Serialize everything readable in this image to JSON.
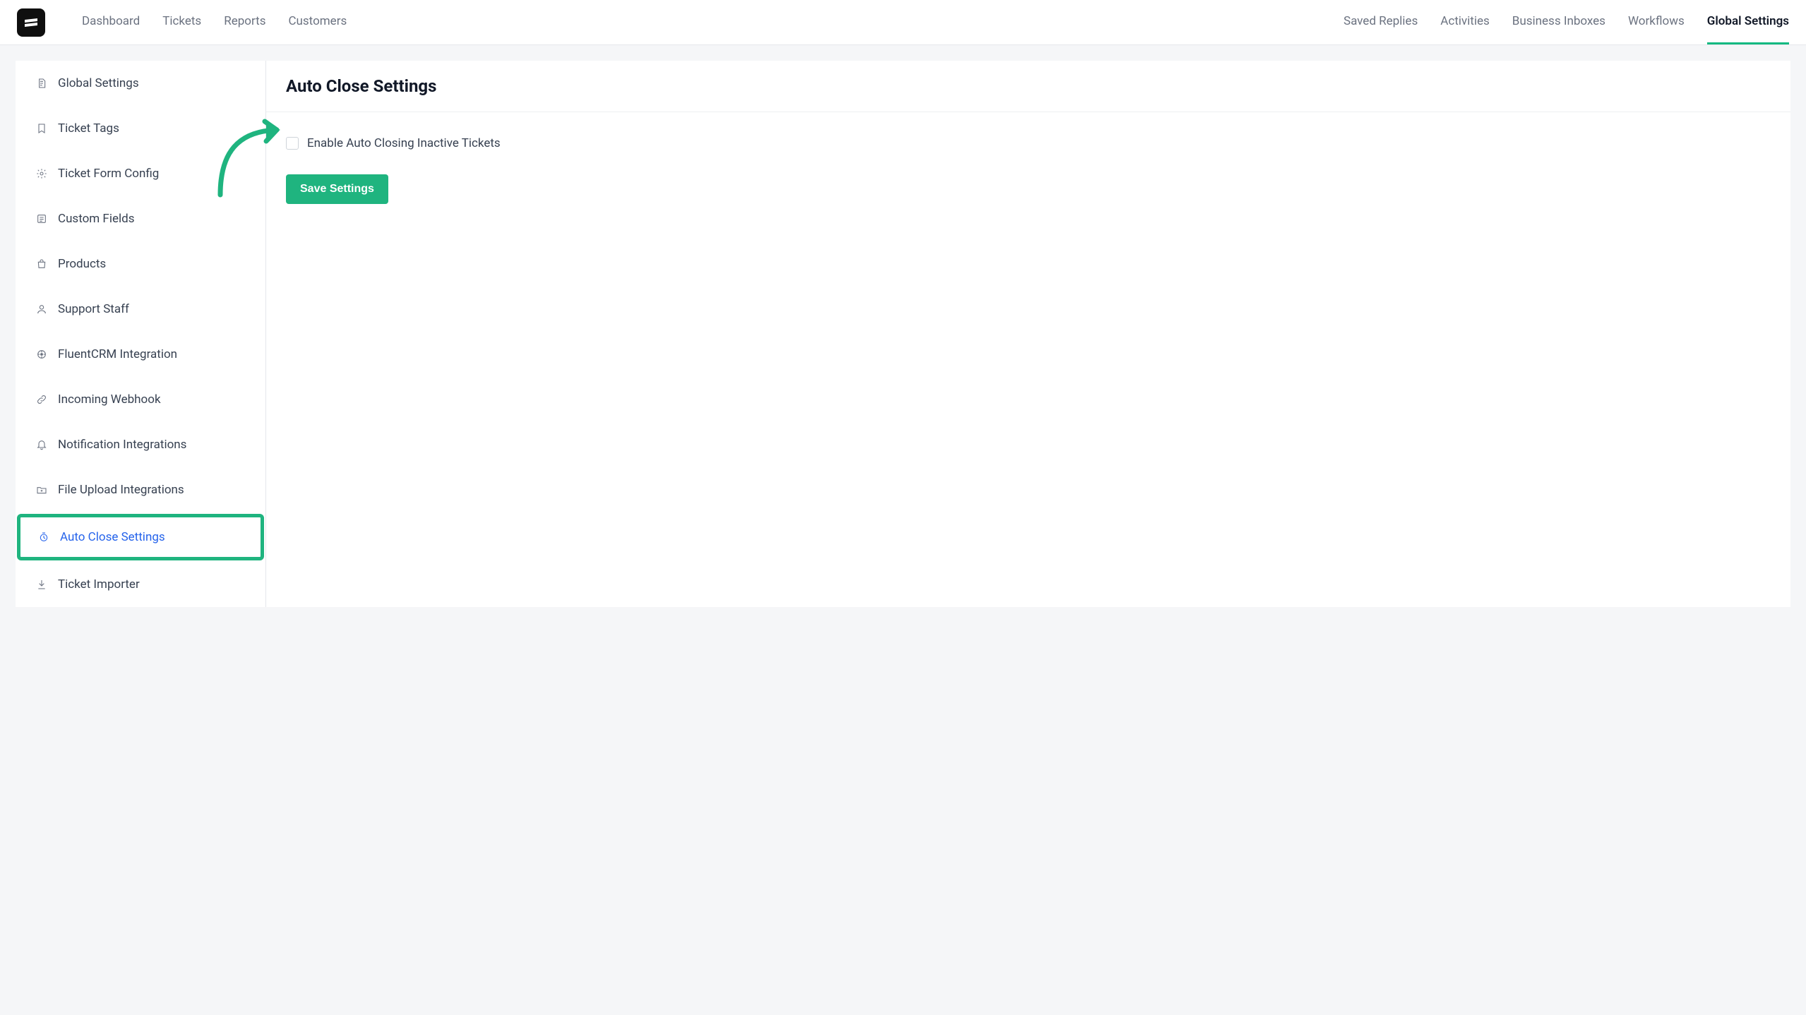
{
  "topnav": {
    "left": [
      {
        "label": "Dashboard"
      },
      {
        "label": "Tickets"
      },
      {
        "label": "Reports"
      },
      {
        "label": "Customers"
      }
    ],
    "right": [
      {
        "label": "Saved Replies",
        "active": false
      },
      {
        "label": "Activities",
        "active": false
      },
      {
        "label": "Business Inboxes",
        "active": false
      },
      {
        "label": "Workflows",
        "active": false
      },
      {
        "label": "Global Settings",
        "active": true
      }
    ]
  },
  "sidebar": {
    "items": [
      {
        "label": "Global Settings",
        "icon": "file-icon"
      },
      {
        "label": "Ticket Tags",
        "icon": "bookmark-icon"
      },
      {
        "label": "Ticket Form Config",
        "icon": "gear-icon"
      },
      {
        "label": "Custom Fields",
        "icon": "list-icon"
      },
      {
        "label": "Products",
        "icon": "bag-icon"
      },
      {
        "label": "Support Staff",
        "icon": "user-icon"
      },
      {
        "label": "FluentCRM Integration",
        "icon": "integration-icon"
      },
      {
        "label": "Incoming Webhook",
        "icon": "link-icon"
      },
      {
        "label": "Notification Integrations",
        "icon": "bell-icon"
      },
      {
        "label": "File Upload Integrations",
        "icon": "folder-plus-icon"
      },
      {
        "label": "Auto Close Settings",
        "icon": "timer-icon",
        "active": true
      },
      {
        "label": "Ticket Importer",
        "icon": "download-icon"
      }
    ]
  },
  "main": {
    "title": "Auto Close Settings",
    "checkbox_label": "Enable Auto Closing Inactive Tickets",
    "save_label": "Save Settings"
  },
  "colors": {
    "accent": "#1fb47f",
    "link_active": "#2563eb"
  }
}
